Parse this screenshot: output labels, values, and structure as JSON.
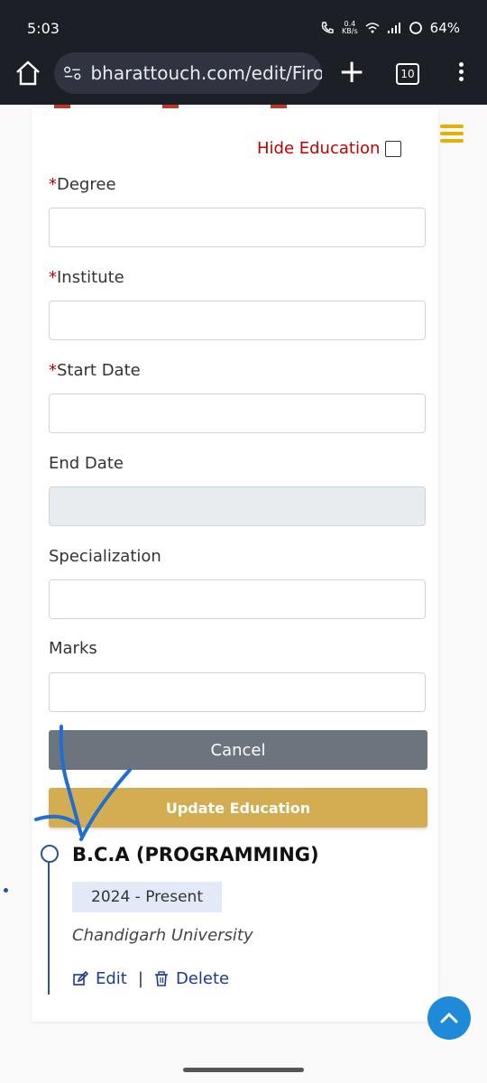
{
  "status_bar": {
    "time": "5:03",
    "speed_value": "0.4",
    "speed_unit": "KB/s",
    "battery": "64%"
  },
  "browser": {
    "url": "bharattouch.com/edit/Firoz.",
    "tab_count": "10"
  },
  "form": {
    "hide_label": "Hide Education",
    "required_mark": "*",
    "fields": [
      {
        "label": "Degree",
        "required": true
      },
      {
        "label": "Institute",
        "required": true
      },
      {
        "label": "Start Date",
        "required": true
      },
      {
        "label": "End Date",
        "required": false,
        "disabled": true
      },
      {
        "label": "Specialization",
        "required": false
      },
      {
        "label": "Marks",
        "required": false
      }
    ],
    "cancel_label": "Cancel",
    "update_label": "Update Education"
  },
  "education_entry": {
    "title": "B.C.A (PROGRAMMING)",
    "date_range": "2024 - Present",
    "institute": "Chandigarh University",
    "edit_label": "Edit",
    "separator": "|",
    "delete_label": "Delete"
  },
  "colors": {
    "accent_gold": "#d4ac51",
    "required_red": "#c00000",
    "link_blue": "#1e3a8a",
    "annotation_blue": "#1f6fd1"
  },
  "icons": [
    "home-icon",
    "settings-icon",
    "plus-icon",
    "tab-switcher-icon",
    "more-vert-icon",
    "hamburger-menu-icon",
    "edit-icon",
    "trash-icon",
    "chevron-up-icon"
  ]
}
